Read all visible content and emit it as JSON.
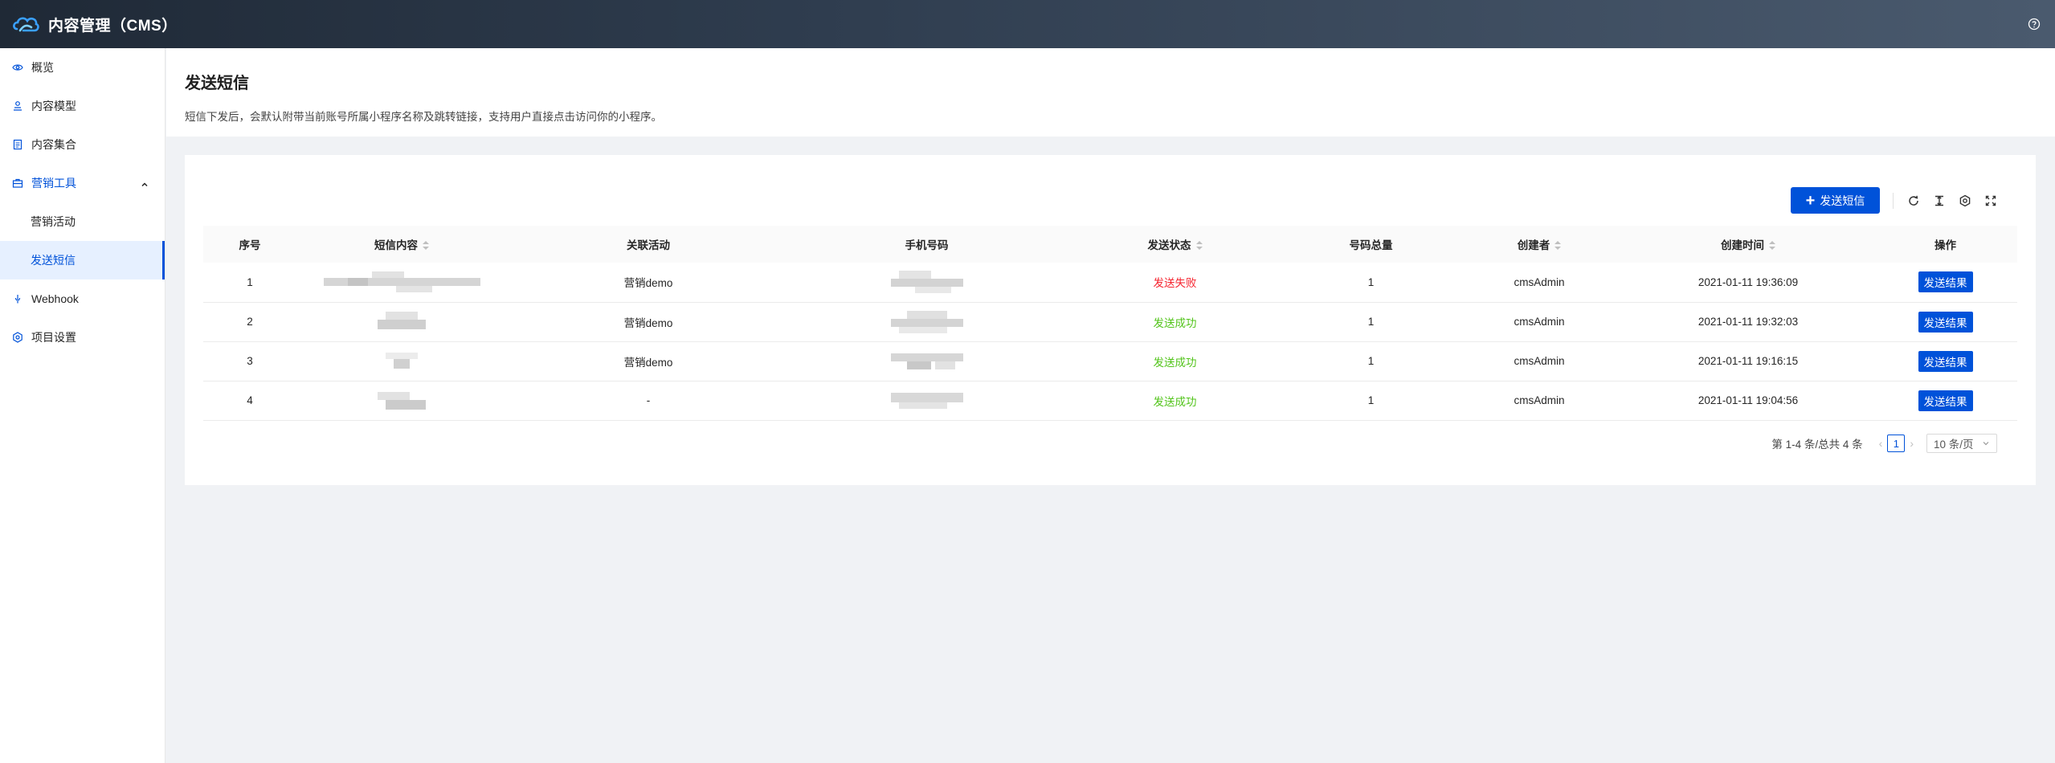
{
  "header": {
    "title": "内容管理（CMS）",
    "logo_icon": "cloud-logo-icon",
    "help_icon": "help-icon"
  },
  "sidebar": {
    "items": [
      {
        "label": "概览",
        "icon": "eye-icon"
      },
      {
        "label": "内容模型",
        "icon": "model-icon"
      },
      {
        "label": "内容集合",
        "icon": "collection-icon"
      },
      {
        "label": "营销工具",
        "icon": "marketing-icon",
        "expanded": true,
        "children": [
          {
            "label": "营销活动"
          },
          {
            "label": "发送短信",
            "active": true
          }
        ]
      },
      {
        "label": "Webhook",
        "icon": "webhook-icon"
      },
      {
        "label": "项目设置",
        "icon": "settings-icon"
      }
    ]
  },
  "page": {
    "title": "发送短信",
    "description": "短信下发后，会默认附带当前账号所属小程序名称及跳转链接，支持用户直接点击访问你的小程序。"
  },
  "toolbar": {
    "send_label": "发送短信"
  },
  "table": {
    "columns": [
      "序号",
      "短信内容",
      "关联活动",
      "手机号码",
      "发送状态",
      "号码总量",
      "创建者",
      "创建时间",
      "操作"
    ],
    "rows": [
      {
        "index": "1",
        "activity": "营销demo",
        "status": "发送失败",
        "status_type": "fail",
        "count": "1",
        "creator": "cmsAdmin",
        "time": "2021-01-11 19:36:09",
        "action": "发送结果"
      },
      {
        "index": "2",
        "activity": "营销demo",
        "status": "发送成功",
        "status_type": "ok",
        "count": "1",
        "creator": "cmsAdmin",
        "time": "2021-01-11 19:32:03",
        "action": "发送结果"
      },
      {
        "index": "3",
        "activity": "营销demo",
        "status": "发送成功",
        "status_type": "ok",
        "count": "1",
        "creator": "cmsAdmin",
        "time": "2021-01-11 19:16:15",
        "action": "发送结果"
      },
      {
        "index": "4",
        "activity": "-",
        "status": "发送成功",
        "status_type": "ok",
        "count": "1",
        "creator": "cmsAdmin",
        "time": "2021-01-11 19:04:56",
        "action": "发送结果"
      }
    ]
  },
  "pagination": {
    "summary": "第 1-4 条/总共 4 条",
    "current_page": "1",
    "page_size": "10 条/页"
  },
  "colors": {
    "primary": "#0052d9",
    "fail": "#f5222d",
    "success": "#52c41a"
  }
}
